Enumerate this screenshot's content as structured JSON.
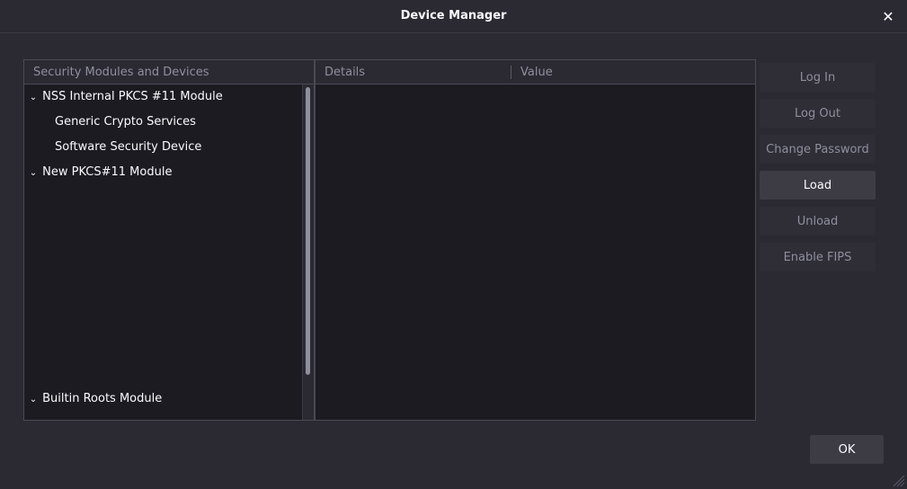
{
  "window": {
    "title": "Device Manager",
    "close_glyph": "✕"
  },
  "tree": {
    "header": "Security Modules and Devices",
    "rows": [
      {
        "label": "NSS Internal PKCS #11 Module",
        "expanded": true,
        "level": 0
      },
      {
        "label": "Generic Crypto Services",
        "level": 1
      },
      {
        "label": "Software Security Device",
        "level": 1
      },
      {
        "label": "New PKCS#11 Module",
        "expanded": true,
        "level": 0
      },
      {
        "label": "Builtin Roots Module",
        "expanded": true,
        "level": 0
      }
    ],
    "twisty_glyph": "⌄"
  },
  "details": {
    "col_details": "Details",
    "col_value": "Value"
  },
  "buttons": {
    "log_in": "Log In",
    "log_out": "Log Out",
    "change_password": "Change Password",
    "load": "Load",
    "unload": "Unload",
    "enable_fips": "Enable FIPS",
    "ok": "OK"
  },
  "colors": {
    "background": "#2b2a33",
    "panel": "#1c1b22",
    "text": "#fbfbfe",
    "disabled_text": "#8f8f9d"
  }
}
